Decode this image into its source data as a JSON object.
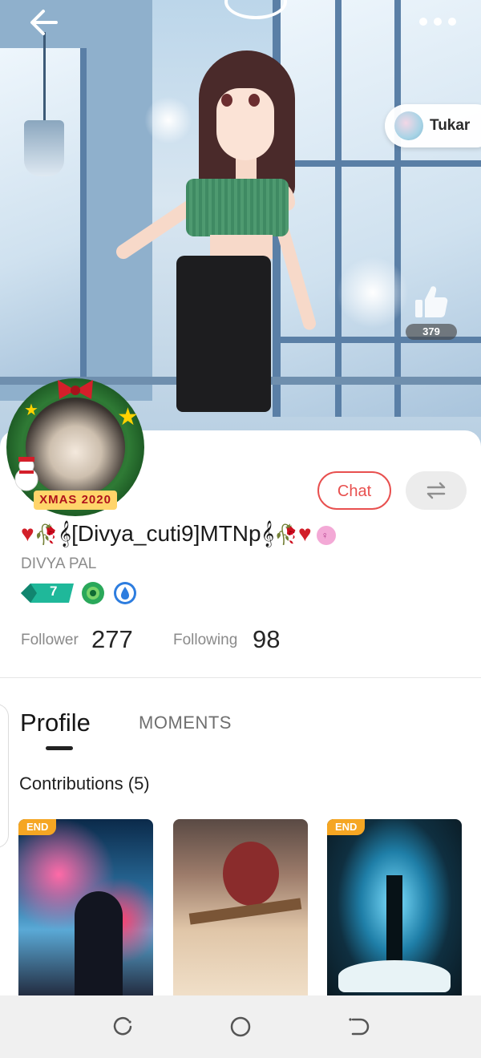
{
  "header": {
    "back_icon": "back-arrow-icon",
    "more_icon": "more-dots-icon"
  },
  "chip": {
    "label": "Tukar"
  },
  "likes": {
    "count": "379",
    "icon": "thumbs-up-icon"
  },
  "avatar": {
    "frame_text": "XMAS 2020"
  },
  "actions": {
    "chat_label": "Chat",
    "swap_icon": "swap-arrows-icon"
  },
  "user": {
    "display_name_core": "[Divya_cuti9]MTNp",
    "real_name": "DIVYA PAL",
    "level": "7",
    "gender_icon": "female-gender-icon"
  },
  "stats": {
    "follower_label": "Follower",
    "follower_count": "277",
    "following_label": "Following",
    "following_count": "98"
  },
  "tabs": {
    "profile": "Profile",
    "moments": "MOMENTS"
  },
  "contributions": {
    "title": "Contributions (5)",
    "cards": [
      {
        "badge": "END"
      },
      {
        "badge": ""
      },
      {
        "badge": "END"
      }
    ]
  },
  "colors": {
    "accent": "#e8504f",
    "end_badge": "#f5a623"
  },
  "navbar": {
    "icons": [
      "recent-apps-icon",
      "home-circle-icon",
      "back-nav-icon"
    ]
  }
}
